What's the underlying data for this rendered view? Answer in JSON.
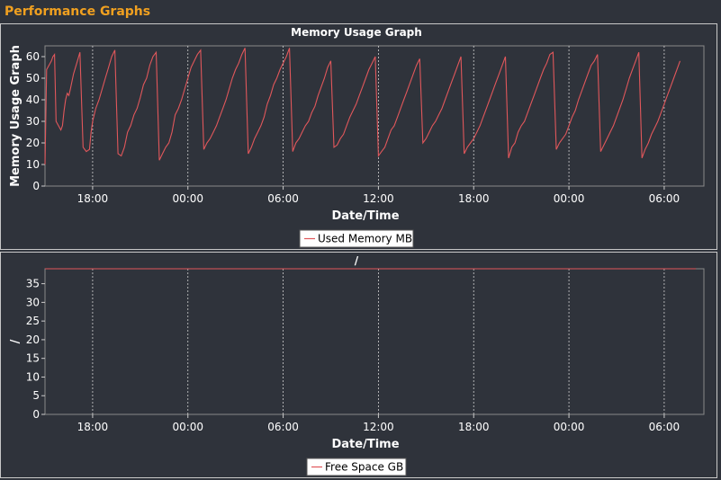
{
  "header": {
    "title": "Performance Graphs"
  },
  "colors": {
    "accent": "#f0a020",
    "series": "#e0575b",
    "plot_bg": "#2f333b",
    "grid": "#d0d0d0"
  },
  "chart_data": [
    {
      "type": "line",
      "title": "Memory Usage Graph",
      "xlabel": "Date/Time",
      "ylabel": "Memory Usage Graph",
      "ylim": [
        0,
        65
      ],
      "yticks": [
        0,
        10,
        20,
        30,
        40,
        50,
        60
      ],
      "x_tick_labels": [
        "18:00",
        "00:00",
        "06:00",
        "12:00",
        "18:00",
        "00:00",
        "06:00"
      ],
      "x_tick_hours": [
        3,
        9,
        15,
        21,
        27,
        33,
        39
      ],
      "xlim_hours": [
        0,
        41.5
      ],
      "grid": "vertical dashed",
      "legend_position": "bottom-center",
      "series": [
        {
          "name": "Used Memory MB",
          "color": "#e0575b",
          "x_hours": [
            0.0,
            0.1,
            0.4,
            0.5,
            0.6,
            0.7,
            1.0,
            1.1,
            1.2,
            1.3,
            1.4,
            1.5,
            1.6,
            1.8,
            2.0,
            2.2,
            2.4,
            2.6,
            2.8,
            2.9,
            3.0,
            3.2,
            3.4,
            3.6,
            3.8,
            4.0,
            4.2,
            4.4,
            4.6,
            4.8,
            5.0,
            5.2,
            5.4,
            5.6,
            5.8,
            6.0,
            6.2,
            6.4,
            6.6,
            6.8,
            7.0,
            7.2,
            7.4,
            7.6,
            7.8,
            8.0,
            8.2,
            8.4,
            8.6,
            8.8,
            9.0,
            9.2,
            9.4,
            9.6,
            9.8,
            10.0,
            10.2,
            10.4,
            10.6,
            10.8,
            11.0,
            11.2,
            11.4,
            11.6,
            11.8,
            12.0,
            12.2,
            12.4,
            12.6,
            12.8,
            13.0,
            13.2,
            13.4,
            13.6,
            13.8,
            14.0,
            14.2,
            14.4,
            14.6,
            14.8,
            15.0,
            15.2,
            15.4,
            15.6,
            15.8,
            16.0,
            16.2,
            16.4,
            16.6,
            16.8,
            17.0,
            17.2,
            17.4,
            17.6,
            17.8,
            18.0,
            18.2,
            18.4,
            18.6,
            18.8,
            19.0,
            19.2,
            19.4,
            19.6,
            19.8,
            20.0,
            20.2,
            20.4,
            20.6,
            20.8,
            21.0,
            21.2,
            21.4,
            21.6,
            21.8,
            22.0,
            22.2,
            22.4,
            22.6,
            22.8,
            23.0,
            23.2,
            23.4,
            23.6,
            23.8,
            24.0,
            24.2,
            24.4,
            24.6,
            24.8,
            25.0,
            25.2,
            25.4,
            25.6,
            25.8,
            26.0,
            26.2,
            26.4,
            26.6,
            26.8,
            27.0,
            27.2,
            27.4,
            27.6,
            27.8,
            28.0,
            28.2,
            28.4,
            28.6,
            28.8,
            29.0,
            29.2,
            29.4,
            29.6,
            29.8,
            30.0,
            30.2,
            30.4,
            30.6,
            30.8,
            31.0,
            31.2,
            31.4,
            31.6,
            31.8,
            32.0,
            32.2,
            32.4,
            32.6,
            32.8,
            33.0,
            33.2,
            33.4,
            33.6,
            33.8,
            34.0,
            34.2,
            34.4,
            34.6,
            34.8,
            35.0,
            35.2,
            35.4,
            35.6,
            35.8,
            36.0,
            36.2,
            36.4,
            36.6,
            36.8,
            37.0,
            37.2,
            37.4,
            37.6,
            37.8,
            38.0,
            38.2,
            38.4,
            38.6,
            38.8,
            39.0,
            39.2,
            39.4,
            39.6,
            39.8,
            40.0,
            40.2,
            40.4,
            40.6,
            40.8,
            41.0
          ],
          "values": [
            10,
            54,
            58,
            60,
            61,
            30,
            26,
            28,
            35,
            40,
            43,
            42,
            45,
            52,
            57,
            62,
            18,
            16,
            17,
            25,
            30,
            36,
            40,
            45,
            50,
            55,
            60,
            63,
            15,
            14,
            18,
            25,
            28,
            33,
            36,
            41,
            47,
            50,
            56,
            60,
            62,
            12,
            15,
            18,
            20,
            25,
            33,
            36,
            40,
            45,
            50,
            55,
            58,
            61,
            63,
            17,
            20,
            22,
            25,
            28,
            32,
            36,
            40,
            45,
            50,
            54,
            57,
            61,
            64,
            15,
            18,
            22,
            25,
            28,
            32,
            38,
            42,
            47,
            50,
            54,
            57,
            60,
            64,
            16,
            20,
            22,
            25,
            28,
            30,
            34,
            37,
            42,
            46,
            50,
            55,
            58,
            18,
            19,
            22,
            24,
            28,
            32,
            35,
            38,
            42,
            46,
            50,
            54,
            57,
            60,
            14,
            16,
            18,
            22,
            26,
            28,
            32,
            36,
            40,
            44,
            48,
            52,
            56,
            59,
            20,
            22,
            25,
            28,
            30,
            33,
            36,
            40,
            44,
            48,
            52,
            56,
            60,
            15,
            18,
            20,
            22,
            25,
            28,
            32,
            36,
            40,
            44,
            48,
            52,
            56,
            60,
            13,
            18,
            20,
            25,
            28,
            30,
            34,
            38,
            42,
            46,
            50,
            54,
            57,
            61,
            62,
            17,
            20,
            22,
            24,
            28,
            32,
            35,
            40,
            44,
            48,
            52,
            56,
            58,
            61,
            16,
            19,
            22,
            25,
            28,
            32,
            36,
            40,
            45,
            50,
            54,
            58,
            62,
            13,
            17,
            20,
            24,
            27,
            30,
            34,
            38,
            42,
            46,
            50,
            54,
            58
          ]
        }
      ]
    },
    {
      "type": "line",
      "title": "/",
      "xlabel": "Date/Time",
      "ylabel": "/",
      "ylim": [
        0,
        39
      ],
      "yticks": [
        0,
        5,
        10,
        15,
        20,
        25,
        30,
        35
      ],
      "x_tick_labels": [
        "18:00",
        "00:00",
        "06:00",
        "12:00",
        "18:00",
        "00:00",
        "06:00"
      ],
      "x_tick_hours": [
        3,
        9,
        15,
        21,
        27,
        33,
        39
      ],
      "xlim_hours": [
        0,
        41.5
      ],
      "grid": "vertical dashed",
      "legend_position": "bottom-center",
      "series": [
        {
          "name": "Free Space GB",
          "color": "#e0575b",
          "x_hours": [
            0.0,
            41.0
          ],
          "values": [
            39,
            39
          ]
        }
      ]
    }
  ]
}
